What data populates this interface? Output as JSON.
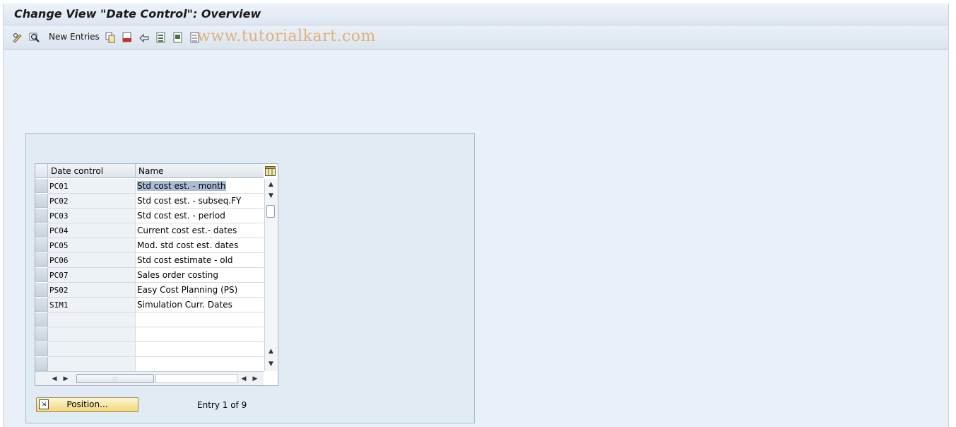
{
  "title": "Change View \"Date Control\": Overview",
  "watermark": "www.tutorialkart.com",
  "toolbar": {
    "new_entries_label": "New Entries",
    "icons": [
      "edit-glasses-icon",
      "find-icon",
      "copy-icon",
      "delete-icon",
      "undo-icon",
      "select-all-icon",
      "select-block-icon",
      "deselect-all-icon"
    ]
  },
  "table": {
    "columns": [
      "Date control",
      "Name"
    ],
    "rows": [
      {
        "code": "PC01",
        "name": "Std cost est. - month"
      },
      {
        "code": "PC02",
        "name": "Std cost est. - subseq.FY"
      },
      {
        "code": "PC03",
        "name": "Std cost est. - period"
      },
      {
        "code": "PC04",
        "name": "Current cost est.- dates"
      },
      {
        "code": "PC05",
        "name": "Mod. std cost est. dates"
      },
      {
        "code": "PC06",
        "name": "Std cost estimate - old"
      },
      {
        "code": "PC07",
        "name": "Sales order costing"
      },
      {
        "code": "PS02",
        "name": "Easy Cost Planning (PS)"
      },
      {
        "code": "SIM1",
        "name": "Simulation Curr. Dates"
      },
      {
        "code": "",
        "name": ""
      },
      {
        "code": "",
        "name": ""
      },
      {
        "code": "",
        "name": ""
      },
      {
        "code": "",
        "name": ""
      }
    ],
    "selected_row": 0
  },
  "position_button_label": "Position...",
  "entry_info": "Entry 1 of 9",
  "colors": {
    "accent": "#a9bdd6",
    "button": "#f2d67a",
    "background": "#e9f0f8"
  }
}
